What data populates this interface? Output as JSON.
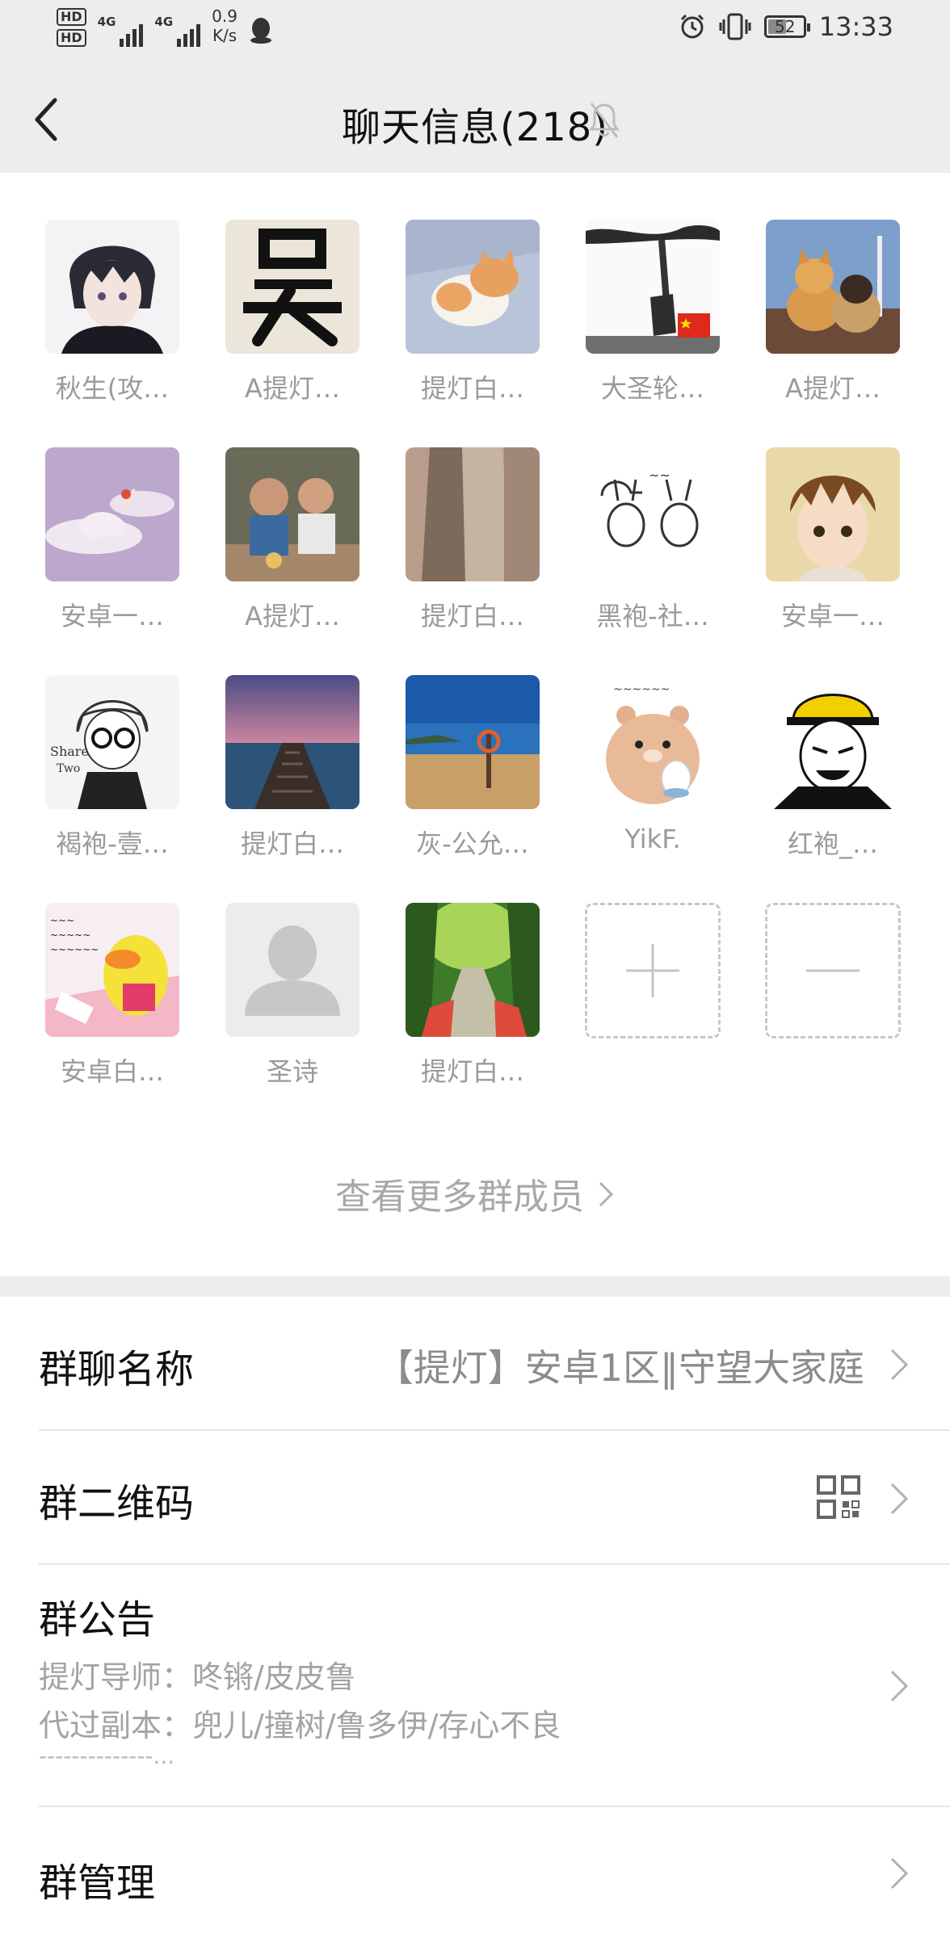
{
  "status_bar": {
    "hd1": "HD",
    "hd2": "HD",
    "net1": "4G",
    "net2": "4G",
    "speed_value": "0.9",
    "speed_unit": "K/s",
    "battery": "52",
    "time": "13:33"
  },
  "header": {
    "title": "聊天信息(218)"
  },
  "members": [
    {
      "name": "秋生(攻…",
      "avatar": "anime-boy"
    },
    {
      "name": "A提灯…",
      "avatar": "calligraphy-wu"
    },
    {
      "name": "提灯白…",
      "avatar": "sleeping-cat"
    },
    {
      "name": "大圣轮…",
      "avatar": "tree-flag"
    },
    {
      "name": "A提灯…",
      "avatar": "two-dogs"
    },
    {
      "name": "安卓一…",
      "avatar": "unicorn-cloud"
    },
    {
      "name": "A提灯…",
      "avatar": "two-kids"
    },
    {
      "name": "提灯白…",
      "avatar": "person-photo"
    },
    {
      "name": "黑袍-社…",
      "avatar": "bunny-doodle"
    },
    {
      "name": "安卓一…",
      "avatar": "anime-kid"
    },
    {
      "name": "褐袍-壹…",
      "avatar": "glasses-boy"
    },
    {
      "name": "提灯白…",
      "avatar": "pier-sunset"
    },
    {
      "name": "灰-公允…",
      "avatar": "beach"
    },
    {
      "name": "YikF.",
      "avatar": "bear-rice"
    },
    {
      "name": "红袍_…",
      "avatar": "meme-helmet"
    },
    {
      "name": "安卓白…",
      "avatar": "duck-toy"
    },
    {
      "name": "圣诗",
      "avatar": "default-user"
    },
    {
      "name": "提灯白…",
      "avatar": "forest-path"
    }
  ],
  "add_member": "+",
  "remove_member": "—",
  "more_members": "查看更多群成员",
  "settings": {
    "group_name_label": "群聊名称",
    "group_name_value": "【提灯】安卓1区‖守望大家庭",
    "qr_label": "群二维码",
    "notice_label": "群公告",
    "notice_line1": "提灯导师：咚锵/皮皮鲁",
    "notice_line2": "代过副本：兜儿/撞树/鲁多伊/存心不良",
    "notice_line3": "--------------...",
    "manage_label": "群管理"
  }
}
